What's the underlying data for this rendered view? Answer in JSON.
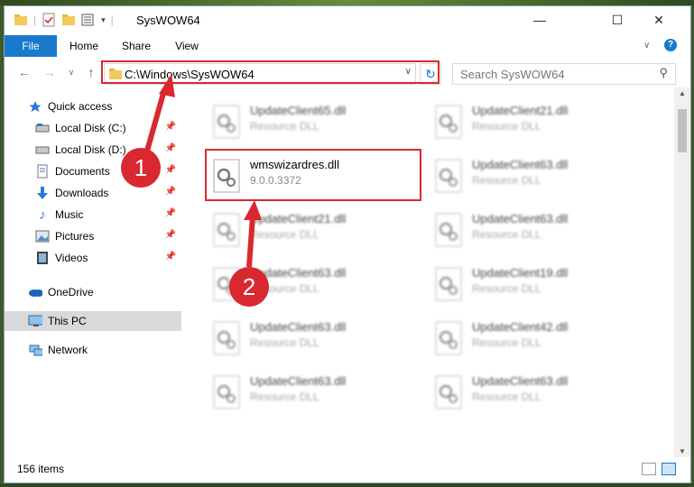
{
  "window": {
    "title": "SysWOW64",
    "controls": {
      "minimize": "—",
      "maximize": "☐",
      "close": "✕"
    }
  },
  "ribbon": {
    "tabs": [
      {
        "label": "File"
      },
      {
        "label": "Home"
      },
      {
        "label": "Share"
      },
      {
        "label": "View"
      }
    ],
    "help_icon": "?"
  },
  "address": {
    "path": "C:\\Windows\\SysWOW64",
    "search_placeholder": "Search SysWOW64"
  },
  "sidebar": {
    "items": [
      {
        "label": "Quick access",
        "icon": "star-icon"
      },
      {
        "label": "Local Disk (C:)",
        "icon": "drive-icon"
      },
      {
        "label": "Local Disk (D:)",
        "icon": "drive-icon"
      },
      {
        "label": "Documents",
        "icon": "documents-icon"
      },
      {
        "label": "Downloads",
        "icon": "downloads-icon"
      },
      {
        "label": "Music",
        "icon": "music-icon"
      },
      {
        "label": "Pictures",
        "icon": "pictures-icon"
      },
      {
        "label": "Videos",
        "icon": "videos-icon"
      },
      {
        "label": "OneDrive",
        "icon": "cloud-icon"
      },
      {
        "label": "This PC",
        "icon": "computer-icon"
      },
      {
        "label": "Network",
        "icon": "network-icon"
      }
    ]
  },
  "files": {
    "highlighted": {
      "name": "wmswizardres.dll",
      "version": "9.0.0.3372"
    },
    "blurred": [
      {
        "name": "UpdateClient65.dll",
        "type": "Resource DLL"
      },
      {
        "name": "UpdateClient21.dll",
        "type": "Resource DLL"
      },
      {
        "name": "UpdateClient63.dll",
        "type": "Resource DLL"
      },
      {
        "name": "UpdateClient21.dll",
        "type": "Resource DLL"
      },
      {
        "name": "UpdateClient63.dll",
        "type": "Resource DLL"
      },
      {
        "name": "UpdateClient63.dll",
        "type": "Resource DLL"
      },
      {
        "name": "UpdateClient19.dll",
        "type": "Resource DLL"
      },
      {
        "name": "UpdateClient63.dll",
        "type": "Resource DLL"
      },
      {
        "name": "UpdateClient42.dll",
        "type": "Resource DLL"
      },
      {
        "name": "UpdateClient63.dll",
        "type": "Resource DLL"
      },
      {
        "name": "UpdateClient63.dll",
        "type": "Resource DLL"
      }
    ]
  },
  "status": {
    "item_count": "156 items"
  },
  "annotations": {
    "step1": "1",
    "step2": "2",
    "color": "#d9282f"
  }
}
